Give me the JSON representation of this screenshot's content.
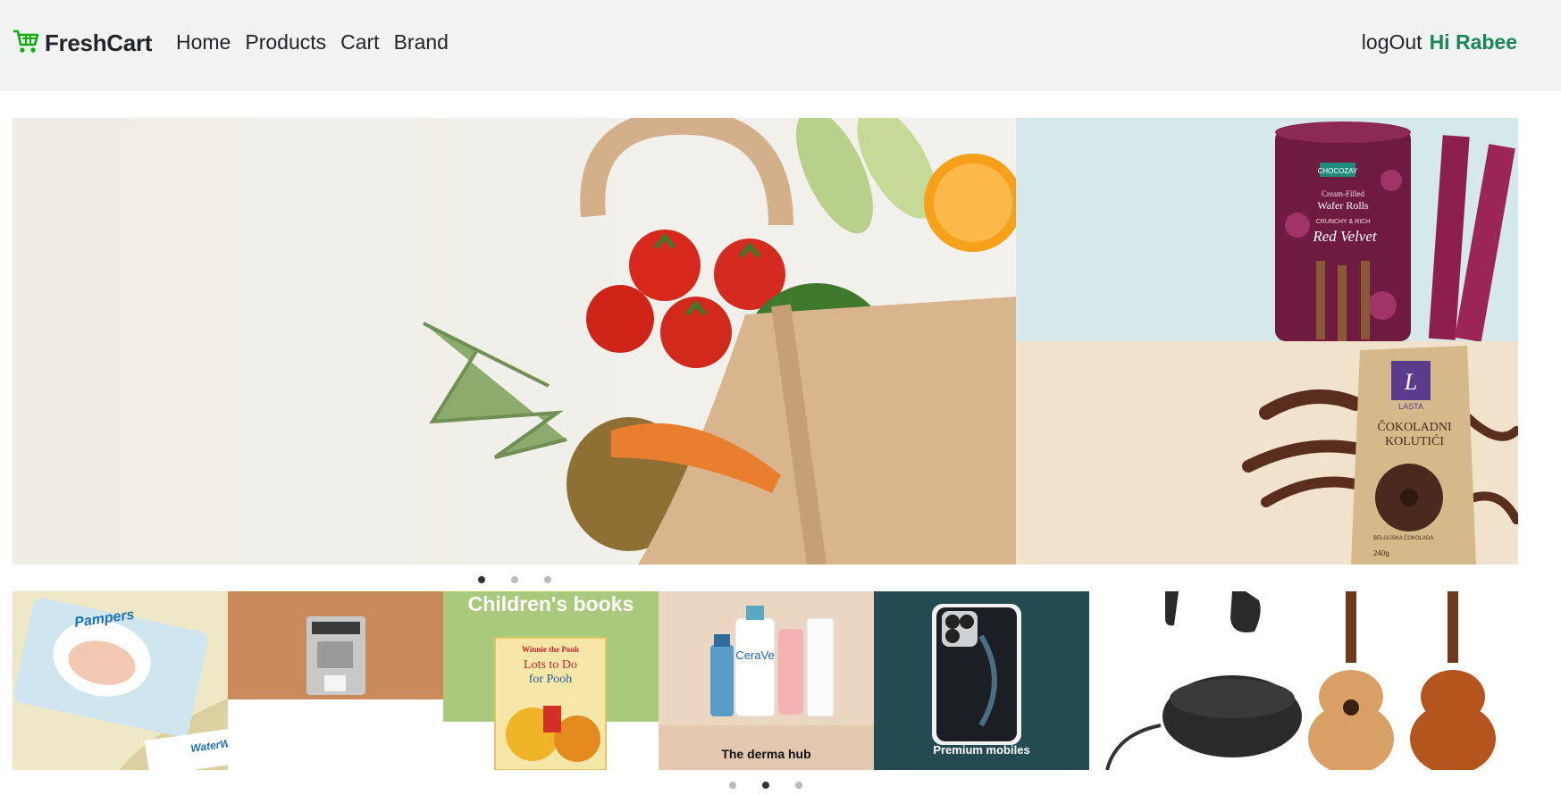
{
  "navbar": {
    "brand": "FreshCart",
    "links": [
      "Home",
      "Products",
      "Cart",
      "Brand"
    ],
    "logout": "logOut",
    "greeting": "Hi Rabee"
  },
  "hero": {
    "slide_count": 3,
    "active_index": 0,
    "side_top_product": {
      "brand": "CHOCOZAY",
      "line1": "Cream-Filled",
      "line2": "Wafer Rolls",
      "line3": "CRUNCHY & RICH",
      "flavor": "Red Velvet"
    },
    "side_bottom_product": {
      "brand": "LASTA",
      "line1": "ČOKOLADNI",
      "line2": "KOLUTIĆI",
      "line3": "BELGIJSKA ČOKOLADA",
      "weight": "240g"
    }
  },
  "categories": {
    "items": [
      {
        "name": "diapers",
        "label": "",
        "brand": "Pampers",
        "brand2": "WaterWipes"
      },
      {
        "name": "coffee-machine",
        "label": ""
      },
      {
        "name": "childrens-books",
        "label": "Children's books",
        "book_title1": "Winnie the Pooh",
        "book_title2": "Lots to Do",
        "book_title3": "for Pooh"
      },
      {
        "name": "derma-hub",
        "label": "The derma hub",
        "brand": "CeraVe"
      },
      {
        "name": "premium-mobiles",
        "label": "Premium mobiles"
      },
      {
        "name": "earbuds",
        "label": ""
      },
      {
        "name": "guitars",
        "label": ""
      }
    ],
    "slide_count": 3,
    "active_index": 1
  },
  "colors": {
    "navbar_bg": "#f0f3f2",
    "accent_green": "#198754",
    "text_dark": "#212529"
  }
}
